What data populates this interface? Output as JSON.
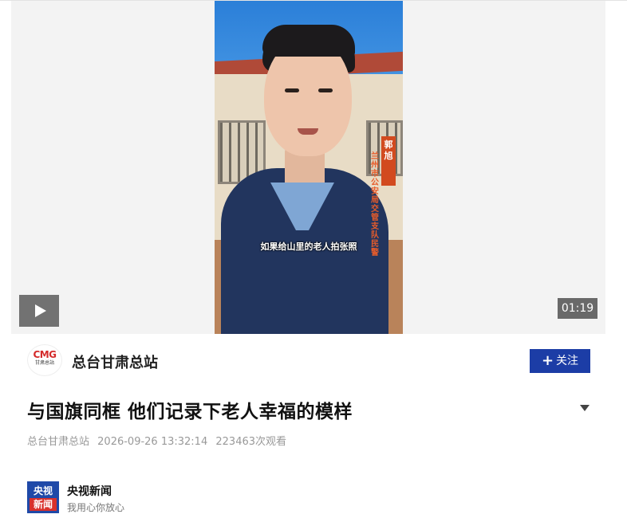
{
  "video": {
    "subtitle": "如果给山里的老人拍张照",
    "name_tag": "郭旭",
    "unit_text": "兰州市公安局交管支队民警",
    "duration": "01:19"
  },
  "channel": {
    "logo_text": "CMG",
    "logo_sub": "甘肃总站",
    "name": "总台甘肃总站",
    "follow_label": "关注"
  },
  "article": {
    "title": "与国旗同框 他们记录下老人幸福的模样",
    "source": "总台甘肃总站",
    "datetime": "2026-09-26 13:32:14",
    "views": "223463次观看"
  },
  "related": {
    "logo_line1": "央视",
    "logo_line2": "新闻",
    "name": "央视新闻",
    "desc": "我用心你放心"
  },
  "colors": {
    "follow_bg": "#1c3da6",
    "cmg_red": "#d42a2a",
    "news_blue": "#1f49a8"
  }
}
